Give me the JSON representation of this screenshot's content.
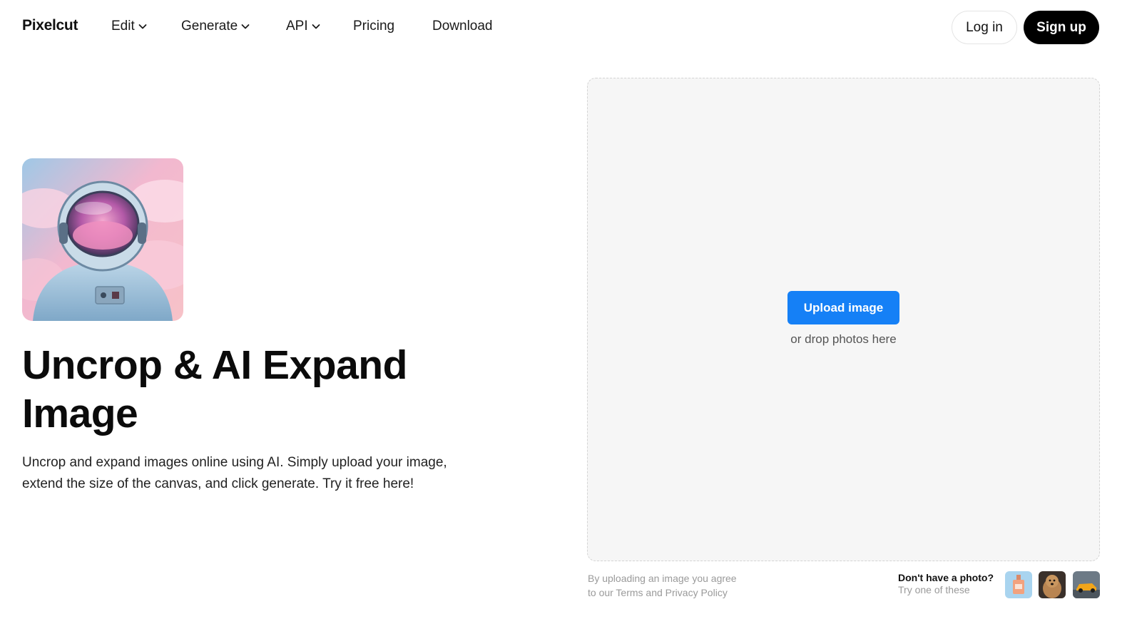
{
  "header": {
    "logo": "Pixelcut",
    "nav": [
      {
        "label": "Edit",
        "has_dropdown": true
      },
      {
        "label": "Generate",
        "has_dropdown": true
      },
      {
        "label": "API",
        "has_dropdown": true
      },
      {
        "label": "Pricing",
        "has_dropdown": false
      },
      {
        "label": "Download",
        "has_dropdown": false
      }
    ],
    "login_label": "Log in",
    "signup_label": "Sign up"
  },
  "hero": {
    "image_icon": "astronaut-illustration",
    "title": "Uncrop & AI Expand Image",
    "description": "Uncrop and expand images online using AI. Simply upload your image, extend the size of the canvas, and click generate. Try it free here!"
  },
  "upload": {
    "button_label": "Upload image",
    "drop_hint": "or drop photos here",
    "terms_line1": "By uploading an image you agree",
    "terms_line2": "to our Terms and Privacy Policy",
    "samples_title": "Don't have a photo?",
    "samples_subtitle": "Try one of these",
    "sample_icons": [
      "perfume-bottle-thumbnail",
      "dog-thumbnail",
      "car-thumbnail"
    ]
  },
  "colors": {
    "accent": "#1580f6",
    "signup_bg": "#000000",
    "dropzone_bg": "#f6f6f6"
  }
}
